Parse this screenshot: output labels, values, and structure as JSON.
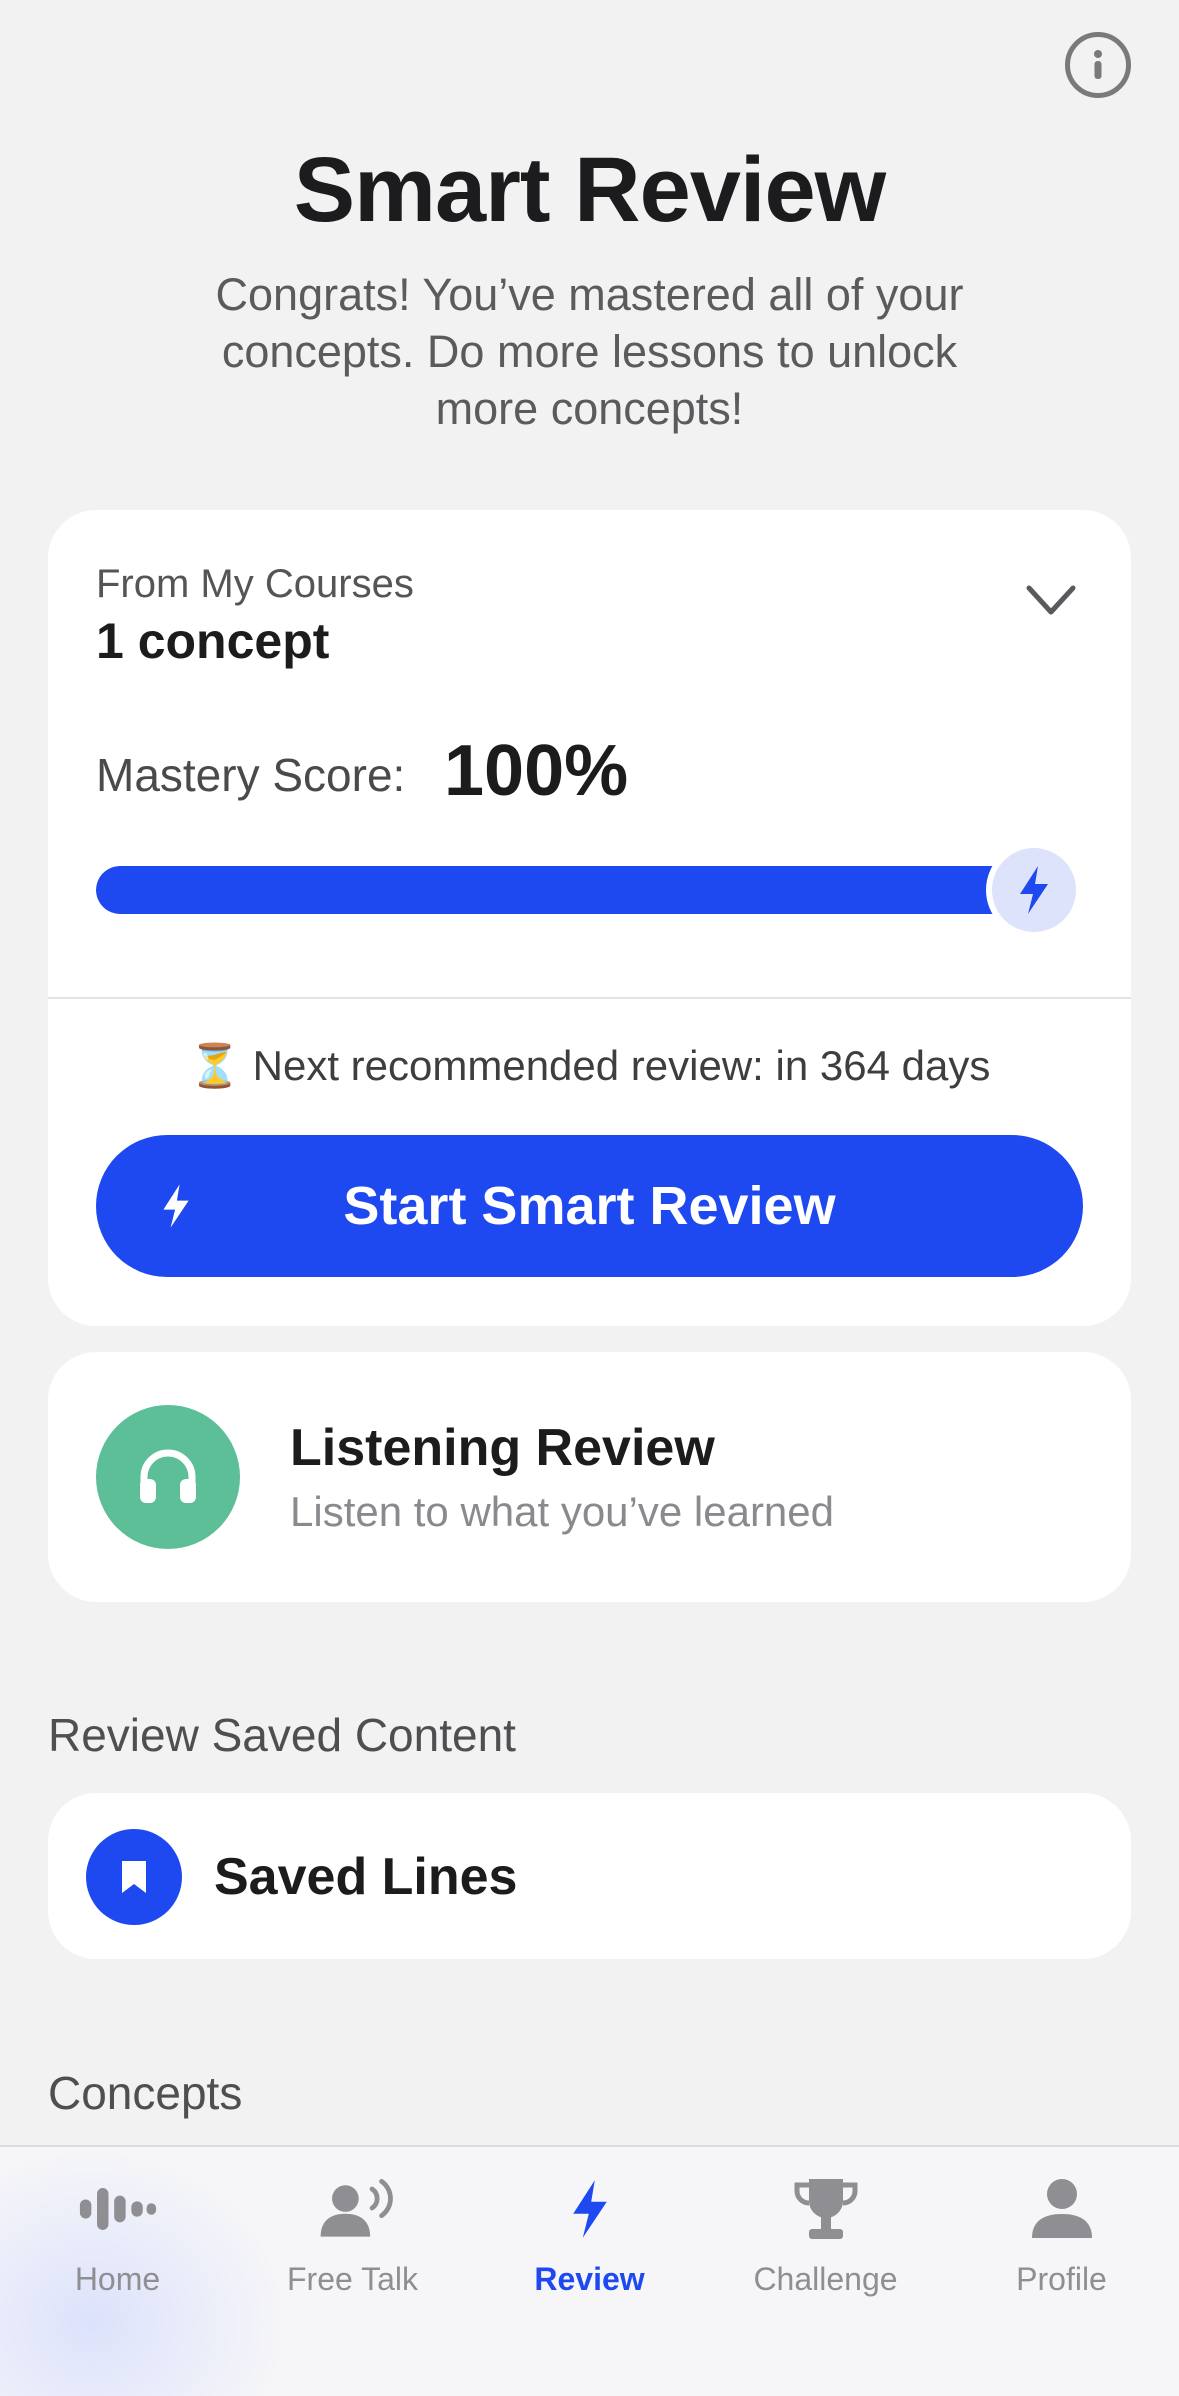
{
  "header": {
    "title": "Smart Review",
    "subtitle": "Congrats! You’ve mastered all of your concepts. Do more lessons to unlock more concepts!",
    "info_icon": "info-icon"
  },
  "smart_review_card": {
    "source_label": "From My Courses",
    "concept_count": "1 concept",
    "mastery_label": "Mastery Score:",
    "mastery_value": "100%",
    "mastery_fraction": 1.0,
    "next_review": "⏳ Next recommended review: in 364 days",
    "start_button_label": "Start Smart Review",
    "accent_color": "#1e49f0"
  },
  "listening_card": {
    "title": "Listening Review",
    "subtitle": "Listen to what you’ve learned",
    "icon": "headphones-icon",
    "icon_color": "#5cbf97"
  },
  "saved_section": {
    "heading": "Review Saved Content",
    "items": [
      {
        "label": "Saved Lines",
        "icon": "bookmark-icon"
      }
    ]
  },
  "concepts_section": {
    "heading": "Concepts"
  },
  "tabbar": {
    "tabs": [
      {
        "label": "Home",
        "icon": "waveform-icon",
        "active": false
      },
      {
        "label": "Free Talk",
        "icon": "speaking-person-icon",
        "active": false
      },
      {
        "label": "Review",
        "icon": "lightning-icon",
        "active": true
      },
      {
        "label": "Challenge",
        "icon": "trophy-icon",
        "active": false
      },
      {
        "label": "Profile",
        "icon": "person-icon",
        "active": false
      }
    ]
  }
}
